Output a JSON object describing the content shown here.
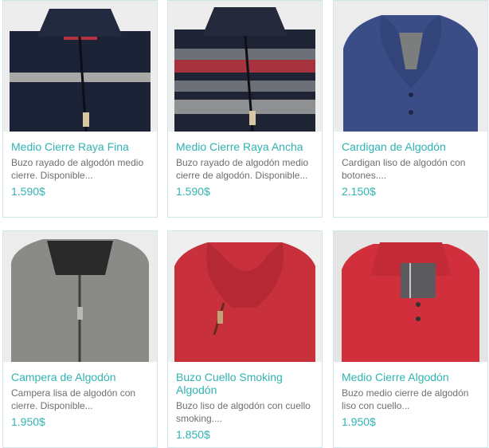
{
  "products": [
    {
      "title": "Medio Cierre Raya Fina",
      "description": "Buzo rayado de algodón medio cierre. Disponible...",
      "price": "1.590$",
      "image_icon": "navy-half-zip-sweater-thin-stripe-image",
      "colors": {
        "body": "#1d2336",
        "stripe": "#a8a9a6",
        "accent": "#b43140"
      }
    },
    {
      "title": "Medio Cierre Raya Ancha",
      "description": "Buzo rayado de algodón medio cierre de algodón. Disponible...",
      "price": "1.590$",
      "image_icon": "navy-half-zip-sweater-wide-stripes-image",
      "colors": {
        "body": "#1f2434",
        "stripe_red": "#a5323c",
        "stripe_gray": "#8f9092"
      }
    },
    {
      "title": "Cardigan de Algodón",
      "description": "Cardigan liso de algodón con botones....",
      "price": "2.150$",
      "image_icon": "blue-shawl-cardigan-image",
      "colors": {
        "body": "#3b4d86"
      }
    },
    {
      "title": "Campera de Algodón",
      "description": "Campera lisa de algodón con cierre. Disponible...",
      "price": "1.950$",
      "image_icon": "gray-zip-jacket-image",
      "colors": {
        "body": "#8a8b87",
        "collar": "#2a2a2a"
      }
    },
    {
      "title": "Buzo Cuello Smoking Algodón",
      "description": "Buzo liso de algodón con cuello smoking....",
      "price": "1.850$",
      "image_icon": "red-shawl-collar-sweater-image",
      "colors": {
        "body": "#c8303c"
      }
    },
    {
      "title": "Medio Cierre Algodón",
      "description": "Buzo medio cierre de algodón liso con cuello...",
      "price": "1.950$",
      "image_icon": "red-half-zip-sweater-image",
      "colors": {
        "body": "#d22f3d"
      }
    }
  ]
}
